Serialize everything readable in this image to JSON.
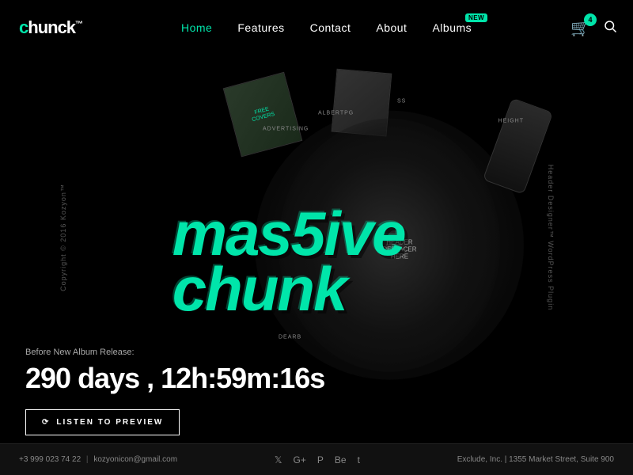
{
  "site": {
    "logo": "chunck",
    "logo_tm": "™"
  },
  "nav": {
    "items": [
      {
        "id": "home",
        "label": "Home",
        "active": true
      },
      {
        "id": "features",
        "label": "Features",
        "active": false
      },
      {
        "id": "contact",
        "label": "Contact",
        "active": false
      },
      {
        "id": "about",
        "label": "About",
        "active": false
      },
      {
        "id": "albums",
        "label": "Albums",
        "active": false
      }
    ],
    "albums_badge": "NEW",
    "cart_count": "4"
  },
  "hero": {
    "title_line1": "mas5ive",
    "title_line2": "chunk",
    "center_label_line1": "HEADER",
    "center_label_line2": "REPLACER",
    "center_label_line3": "HERE",
    "scatter1": "advertising",
    "scatter2": "albertpg",
    "scatter3": "SS",
    "scatter4": "dearb",
    "scatter5": "height"
  },
  "countdown": {
    "label": "Before New Album Release:",
    "value": "290 days , 12h:59m:16s"
  },
  "preview_button": {
    "label": "LISTEN TO PREVIEW",
    "icon": "⟳"
  },
  "sidebar": {
    "left": "Copyright © 2016 Kozyon™",
    "right": "Header Designer™ WordPress Plugin"
  },
  "footer": {
    "phone": "+3 999 023 74 22",
    "email": "kozyonicon@gmail.com",
    "address": "Exclude, Inc. | 1355 Market Street, Suite 900",
    "social_icons": [
      "twitter",
      "google-plus",
      "pinterest",
      "behance",
      "tumblr"
    ]
  },
  "colors": {
    "accent": "#00e5aa",
    "bg": "#000000",
    "text": "#ffffff",
    "muted": "#888888"
  }
}
